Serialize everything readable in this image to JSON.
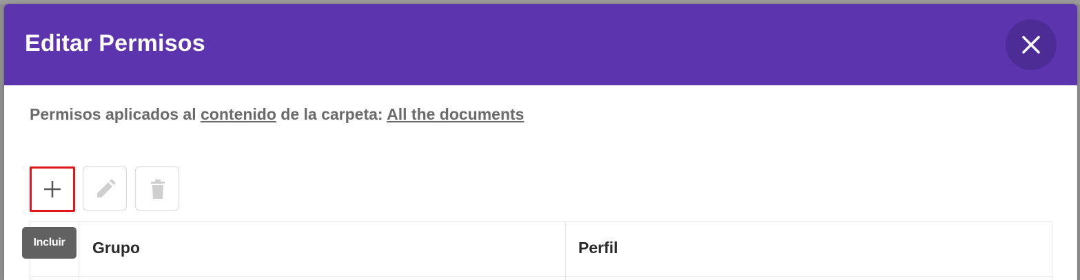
{
  "dialog": {
    "title": "Editar Permisos",
    "close_icon": "close-icon",
    "header_color": "#5b34ae"
  },
  "subtitle": {
    "prefix": "Permisos aplicados al ",
    "content_link": "contenido",
    "middle": " de la carpeta: ",
    "folder_link": "All the documents"
  },
  "toolbar": {
    "add_icon": "plus-icon",
    "edit_icon": "pencil-icon",
    "delete_icon": "trash-icon"
  },
  "tooltip": {
    "text": "Incluir"
  },
  "table": {
    "columns": [
      "Grupo",
      "Perfil"
    ]
  }
}
